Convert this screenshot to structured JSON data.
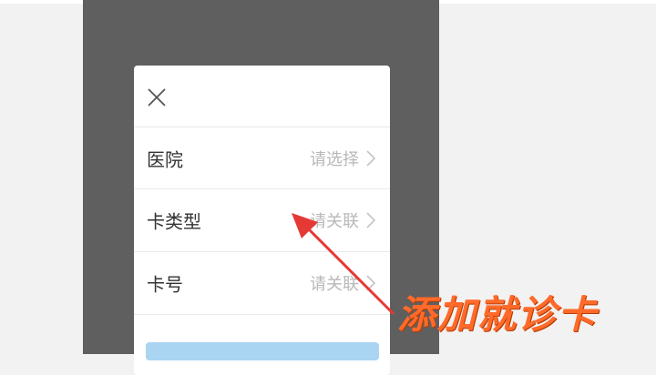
{
  "dialog": {
    "close_icon": "close-icon",
    "rows": [
      {
        "label": "医院",
        "value": "请选择",
        "icon": "chevron-right-icon"
      },
      {
        "label": "卡类型",
        "value": "请关联",
        "icon": "chevron-right-icon"
      },
      {
        "label": "卡号",
        "value": "请关联",
        "icon": "chevron-right-icon"
      }
    ]
  },
  "annotation": {
    "caption": "添加就诊卡",
    "arrow_color": "#e53935",
    "caption_color": "#ff6a2a"
  }
}
